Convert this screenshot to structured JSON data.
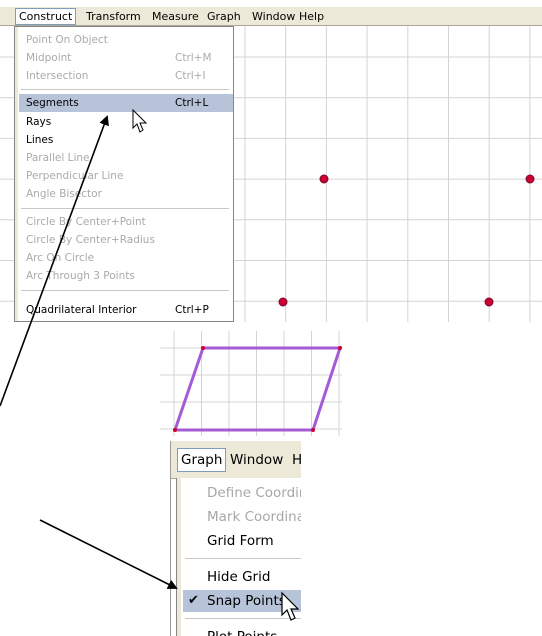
{
  "top_menubar": {
    "items": [
      "Construct",
      "Transform",
      "Measure",
      "Graph",
      "Window",
      "Help"
    ]
  },
  "construct_menu": {
    "groups": [
      [
        {
          "label": "Point On Object",
          "shortcut": "",
          "enabled": false
        },
        {
          "label": "Midpoint",
          "shortcut": "Ctrl+M",
          "enabled": false
        },
        {
          "label": "Intersection",
          "shortcut": "Ctrl+I",
          "enabled": false
        }
      ],
      [
        {
          "label": "Segments",
          "shortcut": "Ctrl+L",
          "enabled": true,
          "highlighted": true
        },
        {
          "label": "Rays",
          "shortcut": "",
          "enabled": true
        },
        {
          "label": "Lines",
          "shortcut": "",
          "enabled": true
        },
        {
          "label": "Parallel Line",
          "shortcut": "",
          "enabled": false
        },
        {
          "label": "Perpendicular Line",
          "shortcut": "",
          "enabled": false
        },
        {
          "label": "Angle Bisector",
          "shortcut": "",
          "enabled": false
        }
      ],
      [
        {
          "label": "Circle By Center+Point",
          "shortcut": "",
          "enabled": false
        },
        {
          "label": "Circle By Center+Radius",
          "shortcut": "",
          "enabled": false
        },
        {
          "label": "Arc On Circle",
          "shortcut": "",
          "enabled": false
        },
        {
          "label": "Arc Through 3 Points",
          "shortcut": "",
          "enabled": false
        }
      ],
      [
        {
          "label": "Quadrilateral Interior",
          "shortcut": "Ctrl+P",
          "enabled": true
        }
      ]
    ]
  },
  "bottom_menubar": {
    "items": [
      "Graph",
      "Window",
      "H"
    ]
  },
  "graph_menu": {
    "groups": [
      [
        {
          "label": "Define Coordinate",
          "enabled": false
        },
        {
          "label": "Mark Coordinate S",
          "enabled": false
        },
        {
          "label": "Grid Form",
          "enabled": true
        }
      ],
      [
        {
          "label": "Hide Grid",
          "enabled": true
        },
        {
          "label": "Snap Points",
          "enabled": true,
          "checked": true,
          "highlighted": true
        }
      ],
      [
        {
          "label": "Plot Points",
          "enabled": true
        }
      ]
    ]
  },
  "colors": {
    "point": "#cc0033",
    "parallelogram": "#a55bd6",
    "grid": "#d4d4d4",
    "menu_highlight": "#b7c3d8",
    "menubar": "#ece9d8"
  },
  "icons": [
    "mouse-cursor-icon",
    "checkmark-icon",
    "annotation-arrow"
  ]
}
